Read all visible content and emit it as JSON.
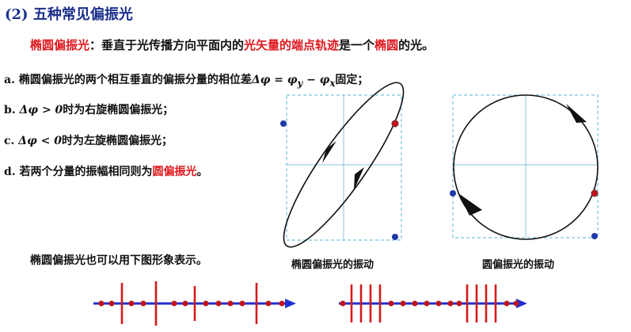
{
  "heading": {
    "number": "(2)",
    "title": "五种常见偏振光"
  },
  "definition": {
    "term": "椭圆偏振光",
    "part1": "：垂直于光传播方向平面内的",
    "highlight": "光矢量的端点轨迹",
    "part2": "是一个",
    "highlight2": "椭圆",
    "part3": "的光。"
  },
  "points": {
    "a": {
      "label": "a.",
      "text": "椭圆偏振光的两个相互垂直的偏振分量的相位差",
      "formula_sym": "Δφ = φ",
      "sub_y": "y",
      "minus": " − φ",
      "sub_x": "x",
      "tail": "固定；"
    },
    "b": {
      "label": "b.",
      "formula": "Δφ > 0",
      "text": "时为右旋椭圆偏振光；"
    },
    "c": {
      "label": "c.",
      "formula": "Δφ < 0",
      "text": "时为左旋椭圆偏振光；"
    },
    "d": {
      "label": "d.",
      "text_before": "若两个分量的振幅相同则为",
      "highlight": "圆偏振光",
      "text_after": "。"
    }
  },
  "note": "椭圆偏振光也可以用下图形象表示。",
  "captions": {
    "ellipse": "椭圆偏振光的振动",
    "circle": "圆偏振光的振动"
  },
  "colors": {
    "heading": "#1a2f8c",
    "highlight": "#e0181e",
    "axis": "#88c4d8",
    "box": "#7cc2e0",
    "arrow": "#1f2fd0",
    "dot_blue": "#1e3aa8",
    "dot_red": "#c0141a",
    "bar": "#d41a1a"
  }
}
